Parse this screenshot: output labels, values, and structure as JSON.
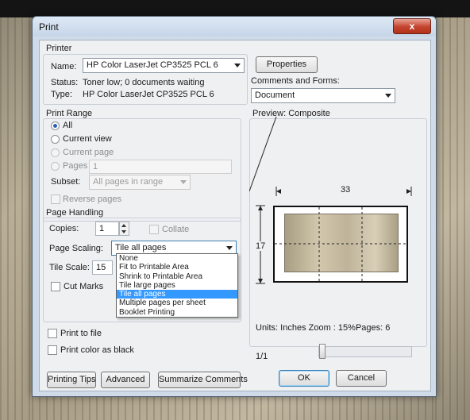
{
  "window": {
    "title": "Print",
    "close_label": "x"
  },
  "printer": {
    "group_label": "Printer",
    "name_label": "Name:",
    "name_value": "HP Color LaserJet CP3525 PCL 6",
    "properties_label": "Properties",
    "status_label": "Status:",
    "status_value": "Toner low; 0 documents waiting",
    "type_label": "Type:",
    "type_value": "HP Color LaserJet CP3525 PCL 6",
    "comments_label": "Comments and Forms:",
    "comments_value": "Document"
  },
  "print_range": {
    "group_label": "Print Range",
    "all_label": "All",
    "current_view_label": "Current view",
    "current_page_label": "Current page",
    "pages_label": "Pages",
    "pages_value": "1",
    "subset_label": "Subset:",
    "subset_value": "All pages in range",
    "reverse_label": "Reverse pages"
  },
  "page_handling": {
    "group_label": "Page Handling",
    "copies_label": "Copies:",
    "copies_value": "1",
    "collate_label": "Collate",
    "scaling_label": "Page Scaling:",
    "scaling_value": "Tile all pages",
    "tile_scale_label": "Tile Scale:",
    "tile_scale_value": "15",
    "cut_marks_label": "Cut Marks",
    "scaling_options": [
      "None",
      "Fit to Printable Area",
      "Shrink to Printable Area",
      "Tile large pages",
      "Tile all pages",
      "Multiple pages per sheet",
      "Booklet Printing"
    ]
  },
  "options": {
    "print_to_file_label": "Print to file",
    "print_black_label": "Print color as black"
  },
  "preview": {
    "label": "Preview: Composite",
    "width_label": "33",
    "height_label": "17",
    "units_text": "Units: Inches Zoom : 15%Pages: 6",
    "page_indicator": "1/1"
  },
  "buttons": {
    "printing_tips": "Printing Tips",
    "advanced": "Advanced",
    "summarize": "Summarize Comments",
    "ok": "OK",
    "cancel": "Cancel"
  }
}
